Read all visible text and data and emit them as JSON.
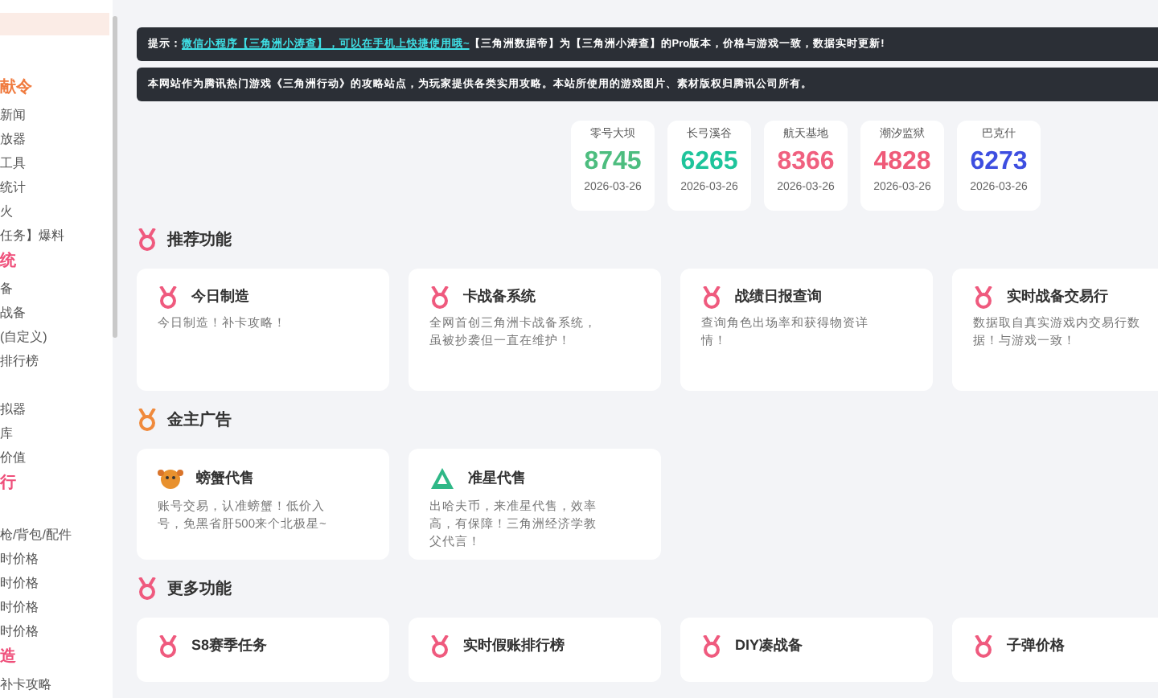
{
  "sidebar": {
    "items": [
      {
        "kind": "heading",
        "label": "献令",
        "color": "#f07b3f"
      },
      {
        "kind": "link",
        "label": "新闻"
      },
      {
        "kind": "link",
        "label": "放器"
      },
      {
        "kind": "link",
        "label": "工具"
      },
      {
        "kind": "link",
        "label": "统计"
      },
      {
        "kind": "link",
        "label": "火"
      },
      {
        "kind": "link",
        "label": "任务】爆料"
      },
      {
        "kind": "heading",
        "label": "统",
        "color": "#ef4f7a"
      },
      {
        "kind": "link",
        "label": "备"
      },
      {
        "kind": "link",
        "label": "战备"
      },
      {
        "kind": "link",
        "label": "(自定义)"
      },
      {
        "kind": "link",
        "label": "排行榜"
      },
      {
        "kind": "gap"
      },
      {
        "kind": "link",
        "label": "拟器"
      },
      {
        "kind": "link",
        "label": "库"
      },
      {
        "kind": "link",
        "label": "价值"
      },
      {
        "kind": "heading",
        "label": "行",
        "color": "#ef4f7a"
      },
      {
        "kind": "gap"
      },
      {
        "kind": "link",
        "label": "枪/背包/配件"
      },
      {
        "kind": "link",
        "label": "时价格"
      },
      {
        "kind": "link",
        "label": "时价格"
      },
      {
        "kind": "link",
        "label": "时价格"
      },
      {
        "kind": "link",
        "label": "时价格"
      },
      {
        "kind": "heading",
        "label": "造",
        "color": "#ef4f7a"
      },
      {
        "kind": "link",
        "label": "补卡攻略"
      }
    ]
  },
  "notices": [
    {
      "prefix": "提示：",
      "link": "微信小程序【三角洲小涛查】，可以在手机上快捷使用哦~",
      "text": "【三角洲数据帝】为【三角洲小涛查】的Pro版本，价格与游戏一致，数据实时更新!"
    },
    {
      "text": "本网站作为腾讯热门游戏《三角洲行动》的攻略站点，为玩家提供各类实用攻略。本站所使用的游戏图片、素材版权归腾讯公司所有。"
    }
  ],
  "stats": [
    {
      "name": "零号大坝",
      "value": "8745",
      "date": "2026-03-26",
      "color": "#4dbd7f"
    },
    {
      "name": "长弓溪谷",
      "value": "6265",
      "date": "2026-03-26",
      "color": "#1ec49b"
    },
    {
      "name": "航天基地",
      "value": "8366",
      "date": "2026-03-26",
      "color": "#f0607f"
    },
    {
      "name": "潮汐监狱",
      "value": "4828",
      "date": "2026-03-26",
      "color": "#ef5a78"
    },
    {
      "name": "巴克什",
      "value": "6273",
      "date": "2026-03-26",
      "color": "#3d4ee0"
    }
  ],
  "sections": [
    {
      "title": "推荐功能",
      "color": "#ef5a7e",
      "cards": [
        {
          "kind": "medal",
          "title": "今日制造",
          "desc": "今日制造！补卡攻略！"
        },
        {
          "kind": "medal",
          "title": "卡战备系统",
          "desc": "全网首创三角洲卡战备系统，虽被抄袭但一直在维护！"
        },
        {
          "kind": "medal",
          "title": "战绩日报查询",
          "desc": "查询角色出场率和获得物资详情！"
        },
        {
          "kind": "medal",
          "title": "实时战备交易行",
          "desc": "数据取自真实游戏内交易行数据！与游戏一致！"
        }
      ]
    },
    {
      "title": "金主广告",
      "color": "#f08a3c",
      "cards": [
        {
          "kind": "crab",
          "title": "螃蟹代售",
          "desc": "账号交易，认准螃蟹！低价入号，免黑省肝500来个北极星~"
        },
        {
          "kind": "pyramid",
          "title": "准星代售",
          "desc": "出哈夫币，来准星代售，效率高，有保障！三角洲经济学教父代言！"
        }
      ]
    },
    {
      "title": "更多功能",
      "color": "#ef5a7e",
      "cards": [
        {
          "kind": "medal",
          "title": "S8赛季任务"
        },
        {
          "kind": "medal",
          "title": "实时假账排行榜"
        },
        {
          "kind": "medal",
          "title": "DIY凑战备"
        },
        {
          "kind": "medal",
          "title": "子弹价格"
        }
      ]
    }
  ]
}
